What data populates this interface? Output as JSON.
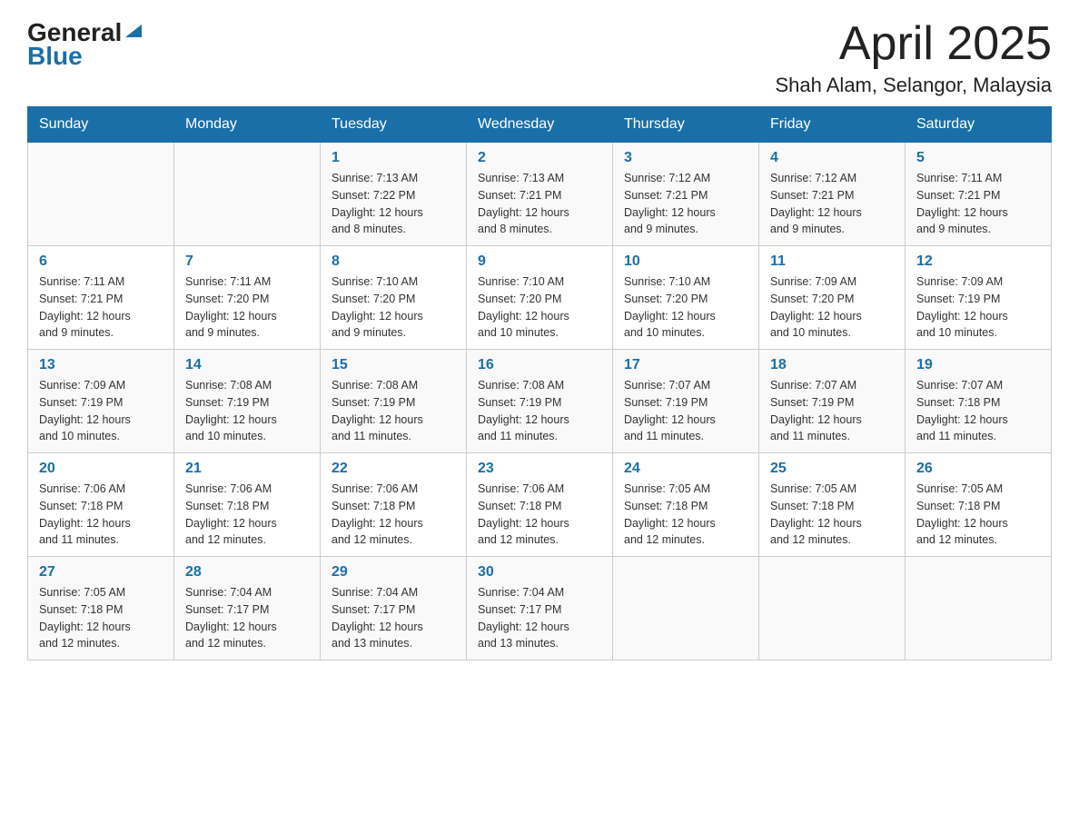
{
  "header": {
    "logo": {
      "general": "General",
      "blue": "Blue"
    },
    "title": "April 2025",
    "location": "Shah Alam, Selangor, Malaysia"
  },
  "weekdays": [
    "Sunday",
    "Monday",
    "Tuesday",
    "Wednesday",
    "Thursday",
    "Friday",
    "Saturday"
  ],
  "weeks": [
    [
      {
        "day": "",
        "info": ""
      },
      {
        "day": "",
        "info": ""
      },
      {
        "day": "1",
        "info": "Sunrise: 7:13 AM\nSunset: 7:22 PM\nDaylight: 12 hours\nand 8 minutes."
      },
      {
        "day": "2",
        "info": "Sunrise: 7:13 AM\nSunset: 7:21 PM\nDaylight: 12 hours\nand 8 minutes."
      },
      {
        "day": "3",
        "info": "Sunrise: 7:12 AM\nSunset: 7:21 PM\nDaylight: 12 hours\nand 9 minutes."
      },
      {
        "day": "4",
        "info": "Sunrise: 7:12 AM\nSunset: 7:21 PM\nDaylight: 12 hours\nand 9 minutes."
      },
      {
        "day": "5",
        "info": "Sunrise: 7:11 AM\nSunset: 7:21 PM\nDaylight: 12 hours\nand 9 minutes."
      }
    ],
    [
      {
        "day": "6",
        "info": "Sunrise: 7:11 AM\nSunset: 7:21 PM\nDaylight: 12 hours\nand 9 minutes."
      },
      {
        "day": "7",
        "info": "Sunrise: 7:11 AM\nSunset: 7:20 PM\nDaylight: 12 hours\nand 9 minutes."
      },
      {
        "day": "8",
        "info": "Sunrise: 7:10 AM\nSunset: 7:20 PM\nDaylight: 12 hours\nand 9 minutes."
      },
      {
        "day": "9",
        "info": "Sunrise: 7:10 AM\nSunset: 7:20 PM\nDaylight: 12 hours\nand 10 minutes."
      },
      {
        "day": "10",
        "info": "Sunrise: 7:10 AM\nSunset: 7:20 PM\nDaylight: 12 hours\nand 10 minutes."
      },
      {
        "day": "11",
        "info": "Sunrise: 7:09 AM\nSunset: 7:20 PM\nDaylight: 12 hours\nand 10 minutes."
      },
      {
        "day": "12",
        "info": "Sunrise: 7:09 AM\nSunset: 7:19 PM\nDaylight: 12 hours\nand 10 minutes."
      }
    ],
    [
      {
        "day": "13",
        "info": "Sunrise: 7:09 AM\nSunset: 7:19 PM\nDaylight: 12 hours\nand 10 minutes."
      },
      {
        "day": "14",
        "info": "Sunrise: 7:08 AM\nSunset: 7:19 PM\nDaylight: 12 hours\nand 10 minutes."
      },
      {
        "day": "15",
        "info": "Sunrise: 7:08 AM\nSunset: 7:19 PM\nDaylight: 12 hours\nand 11 minutes."
      },
      {
        "day": "16",
        "info": "Sunrise: 7:08 AM\nSunset: 7:19 PM\nDaylight: 12 hours\nand 11 minutes."
      },
      {
        "day": "17",
        "info": "Sunrise: 7:07 AM\nSunset: 7:19 PM\nDaylight: 12 hours\nand 11 minutes."
      },
      {
        "day": "18",
        "info": "Sunrise: 7:07 AM\nSunset: 7:19 PM\nDaylight: 12 hours\nand 11 minutes."
      },
      {
        "day": "19",
        "info": "Sunrise: 7:07 AM\nSunset: 7:18 PM\nDaylight: 12 hours\nand 11 minutes."
      }
    ],
    [
      {
        "day": "20",
        "info": "Sunrise: 7:06 AM\nSunset: 7:18 PM\nDaylight: 12 hours\nand 11 minutes."
      },
      {
        "day": "21",
        "info": "Sunrise: 7:06 AM\nSunset: 7:18 PM\nDaylight: 12 hours\nand 12 minutes."
      },
      {
        "day": "22",
        "info": "Sunrise: 7:06 AM\nSunset: 7:18 PM\nDaylight: 12 hours\nand 12 minutes."
      },
      {
        "day": "23",
        "info": "Sunrise: 7:06 AM\nSunset: 7:18 PM\nDaylight: 12 hours\nand 12 minutes."
      },
      {
        "day": "24",
        "info": "Sunrise: 7:05 AM\nSunset: 7:18 PM\nDaylight: 12 hours\nand 12 minutes."
      },
      {
        "day": "25",
        "info": "Sunrise: 7:05 AM\nSunset: 7:18 PM\nDaylight: 12 hours\nand 12 minutes."
      },
      {
        "day": "26",
        "info": "Sunrise: 7:05 AM\nSunset: 7:18 PM\nDaylight: 12 hours\nand 12 minutes."
      }
    ],
    [
      {
        "day": "27",
        "info": "Sunrise: 7:05 AM\nSunset: 7:18 PM\nDaylight: 12 hours\nand 12 minutes."
      },
      {
        "day": "28",
        "info": "Sunrise: 7:04 AM\nSunset: 7:17 PM\nDaylight: 12 hours\nand 12 minutes."
      },
      {
        "day": "29",
        "info": "Sunrise: 7:04 AM\nSunset: 7:17 PM\nDaylight: 12 hours\nand 13 minutes."
      },
      {
        "day": "30",
        "info": "Sunrise: 7:04 AM\nSunset: 7:17 PM\nDaylight: 12 hours\nand 13 minutes."
      },
      {
        "day": "",
        "info": ""
      },
      {
        "day": "",
        "info": ""
      },
      {
        "day": "",
        "info": ""
      }
    ]
  ]
}
